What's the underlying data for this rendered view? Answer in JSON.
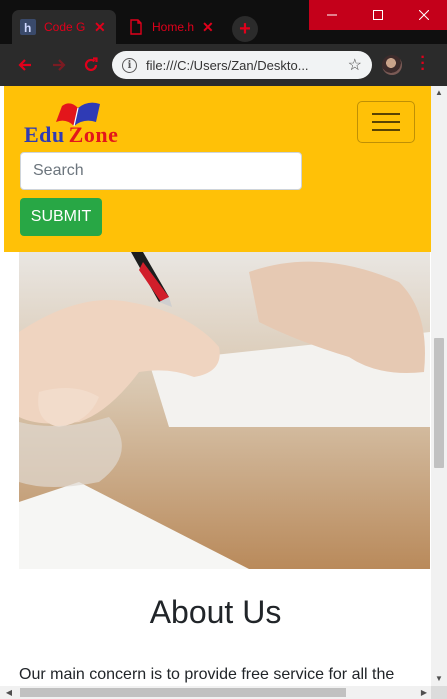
{
  "browser": {
    "tabs": [
      {
        "title": "Code G",
        "favicon": "h-logo-icon",
        "active": true
      },
      {
        "title": "Home.h",
        "favicon": "document-icon",
        "active": false
      }
    ],
    "url": "file:///C:/Users/Zan/Deskto...",
    "accent_color": "#e0001b"
  },
  "navbar": {
    "brand_word_1": "Edu",
    "brand_word_2": "Zone",
    "background": "#ffc107",
    "search_placeholder": "Search",
    "submit_label": "SUBMIT",
    "submit_color": "#28a745"
  },
  "about": {
    "title": "About Us",
    "text": "Our main concern is to provide free service for all the"
  }
}
